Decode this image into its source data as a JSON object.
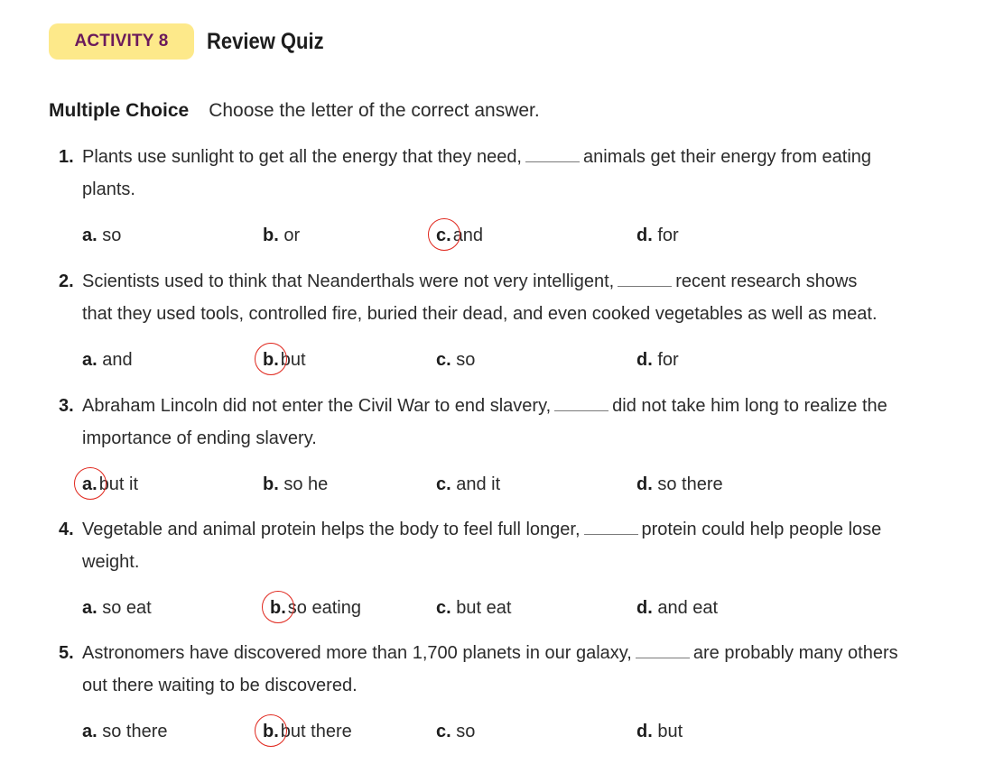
{
  "header": {
    "badge": "ACTIVITY 8",
    "title": "Review Quiz"
  },
  "section": {
    "label": "Multiple Choice",
    "instructions": "Choose the letter of the correct answer."
  },
  "questions": [
    {
      "number": "1.",
      "line1_before": "Plants use sunlight to get all the energy that they need,",
      "line1_after": "animals get their energy from eating",
      "line2": "plants.",
      "options": [
        {
          "letter": "a.",
          "text": "so",
          "selected": false
        },
        {
          "letter": "b.",
          "text": "or",
          "selected": false
        },
        {
          "letter": "c.",
          "text": "and",
          "selected": true
        },
        {
          "letter": "d.",
          "text": "for",
          "selected": false
        }
      ]
    },
    {
      "number": "2.",
      "line1_before": "Scientists used to think that Neanderthals were not very intelligent,",
      "line1_after": "recent research shows",
      "line2": "that they used tools, controlled fire, buried their dead, and even cooked vegetables as well as meat.",
      "options": [
        {
          "letter": "a.",
          "text": "and",
          "selected": false
        },
        {
          "letter": "b.",
          "text": "but",
          "selected": true
        },
        {
          "letter": "c.",
          "text": "so",
          "selected": false
        },
        {
          "letter": "d.",
          "text": "for",
          "selected": false
        }
      ]
    },
    {
      "number": "3.",
      "line1_before": "Abraham Lincoln did not enter the Civil War to end slavery,",
      "line1_after": "did not take him long to realize the",
      "line2": "importance of ending slavery.",
      "options": [
        {
          "letter": "a.",
          "text": "but it",
          "selected": true
        },
        {
          "letter": "b.",
          "text": "so he",
          "selected": false
        },
        {
          "letter": "c.",
          "text": "and it",
          "selected": false
        },
        {
          "letter": "d.",
          "text": "so there",
          "selected": false
        }
      ]
    },
    {
      "number": "4.",
      "line1_before": "Vegetable and animal protein helps the body to feel full longer,",
      "line1_after": "protein could help people lose",
      "line2": "weight.",
      "options": [
        {
          "letter": "a.",
          "text": "so eat",
          "selected": false
        },
        {
          "letter": "b.",
          "text": "so eating",
          "selected": true
        },
        {
          "letter": "c.",
          "text": "but eat",
          "selected": false
        },
        {
          "letter": "d.",
          "text": "and eat",
          "selected": false
        }
      ]
    },
    {
      "number": "5.",
      "line1_before": "Astronomers have discovered more than 1,700 planets in our galaxy,",
      "line1_after": "are probably many others",
      "line2": "out there waiting to be discovered.",
      "options": [
        {
          "letter": "a.",
          "text": "so there",
          "selected": false
        },
        {
          "letter": "b.",
          "text": "but there",
          "selected": true
        },
        {
          "letter": "c.",
          "text": "so",
          "selected": false
        },
        {
          "letter": "d.",
          "text": "but",
          "selected": false
        }
      ]
    }
  ]
}
